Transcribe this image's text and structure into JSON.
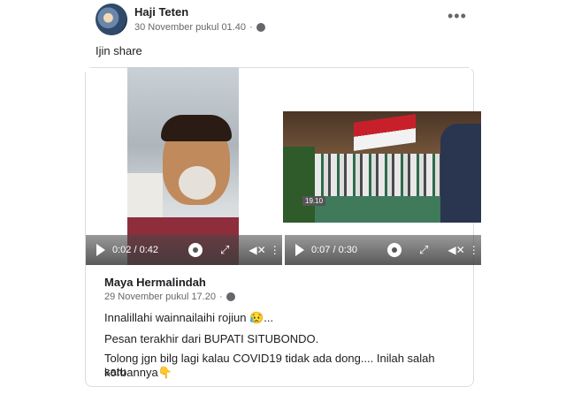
{
  "post": {
    "author": "Haji Teten",
    "timestamp": "30 November pukul 01.40",
    "privacy_icon": "globe-icon",
    "more_label": "•••",
    "caption": "Ijin share"
  },
  "videos": [
    {
      "time": "0:02 / 0:42",
      "icons": [
        "play-icon",
        "gear-icon",
        "expand-icon",
        "mute-icon"
      ]
    },
    {
      "time": "0:07 / 0:30",
      "timestamp_overlay": "19.10",
      "icons": [
        "play-icon",
        "gear-icon",
        "expand-icon",
        "mute-icon"
      ]
    }
  ],
  "shared": {
    "author": "Maya Hermalindah",
    "timestamp": "29 November pukul 17.20",
    "line1": "Innalillahi wainnailaihi rojiun 😥...",
    "line2": "Pesan terakhir dari BUPATI SITUBONDO.",
    "line3": "Tolong jgn bilg lagi kalau COVID19 tidak ada dong.... Inilah salah satu",
    "line4": "korbannya👇"
  }
}
